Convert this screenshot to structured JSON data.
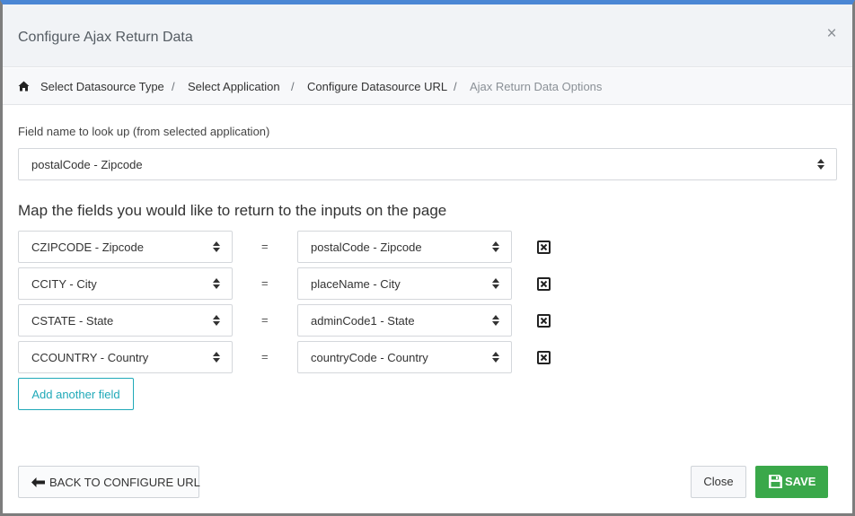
{
  "dialog": {
    "title": "Configure Ajax Return Data",
    "close_symbol": "×"
  },
  "breadcrumb": {
    "home_icon": "home-icon",
    "items": [
      "Select Datasource Type",
      "Select Application",
      "Configure Datasource URL",
      "Ajax Return Data Options"
    ],
    "separator": "/"
  },
  "lookup": {
    "label": "Field name to look up (from selected application)",
    "selected": "postalCode - Zipcode"
  },
  "mapping": {
    "heading": "Map the fields you would like to return to the inputs on the page",
    "equals_symbol": "=",
    "rows": [
      {
        "input": "CZIPCODE - Zipcode",
        "field": "postalCode - Zipcode"
      },
      {
        "input": "CCITY - City",
        "field": "placeName - City"
      },
      {
        "input": "CSTATE - State",
        "field": "adminCode1 - State"
      },
      {
        "input": "CCOUNTRY - Country",
        "field": "countryCode - Country"
      }
    ],
    "add_label": "Add another field"
  },
  "footer": {
    "back_label": "BACK TO CONFIGURE URL",
    "close_label": "Close",
    "save_label": "SAVE"
  },
  "colors": {
    "top_accent": "#4a86d4",
    "add_button": "#1fa9b8",
    "save_button": "#3aa84a"
  }
}
